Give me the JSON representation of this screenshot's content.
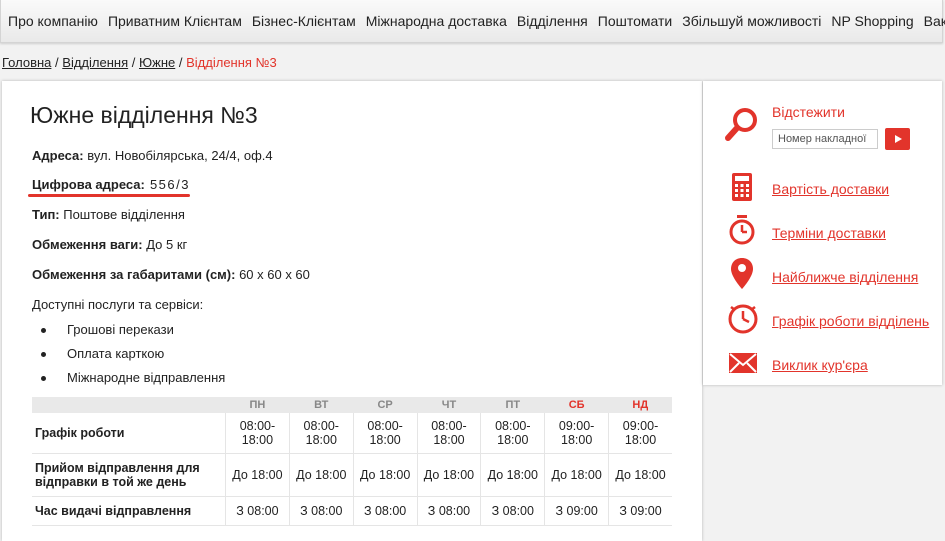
{
  "nav": [
    "Про компанію",
    "Приватним Клієнтам",
    "Бізнес-Клієнтам",
    "Міжнародна доставка",
    "Відділення",
    "Поштомати",
    "Збільшуй можливості",
    "NP Shopping",
    "Вакансії"
  ],
  "breadcrumb": {
    "home": "Головна",
    "sep": "/",
    "branches": "Відділення",
    "city": "Южне",
    "current": "Відділення №3"
  },
  "branch": {
    "title": "Южне відділення №3",
    "address_label": "Адреса:",
    "address_value": " вул. Новобілярська, 24/4, оф.4",
    "digital_label": "Цифрова адреса:",
    "digital_value": " 556/3",
    "type_label": "Тип:",
    "type_value": " Поштове відділення",
    "weight_label": "Обмеження ваги:",
    "weight_value": " До 5 кг",
    "size_label": "Обмеження за габаритами (см):",
    "size_value": " 60 x 60 x 60",
    "services_label": "Доступні послуги та сервіси:",
    "services": [
      "Грошові перекази",
      "Оплата карткою",
      "Міжнародне відправлення"
    ]
  },
  "schedule": {
    "days": [
      "ПН",
      "ВТ",
      "СР",
      "ЧТ",
      "ПТ",
      "СБ",
      "НД"
    ],
    "rows": [
      {
        "label": "Графік роботи",
        "values": [
          "08:00-18:00",
          "08:00-18:00",
          "08:00-18:00",
          "08:00-18:00",
          "08:00-18:00",
          "09:00-18:00",
          "09:00-18:00"
        ]
      },
      {
        "label": "Прийом відправлення для відправки в той же день",
        "values": [
          "До 18:00",
          "До 18:00",
          "До 18:00",
          "До 18:00",
          "До 18:00",
          "До 18:00",
          "До 18:00"
        ]
      },
      {
        "label": "Час видачі відправлення",
        "values": [
          "З 08:00",
          "З 08:00",
          "З 08:00",
          "З 08:00",
          "З 08:00",
          "З 09:00",
          "З 09:00"
        ]
      }
    ]
  },
  "sidebar": {
    "track_title": "Відстежити",
    "track_placeholder": "Номер накладної",
    "links": [
      "Вартість доставки",
      "Терміни доставки",
      "Найближче відділення",
      "Графік роботи відділень",
      "Виклик кур'єра"
    ]
  },
  "colors": {
    "accent": "#e2342b"
  }
}
